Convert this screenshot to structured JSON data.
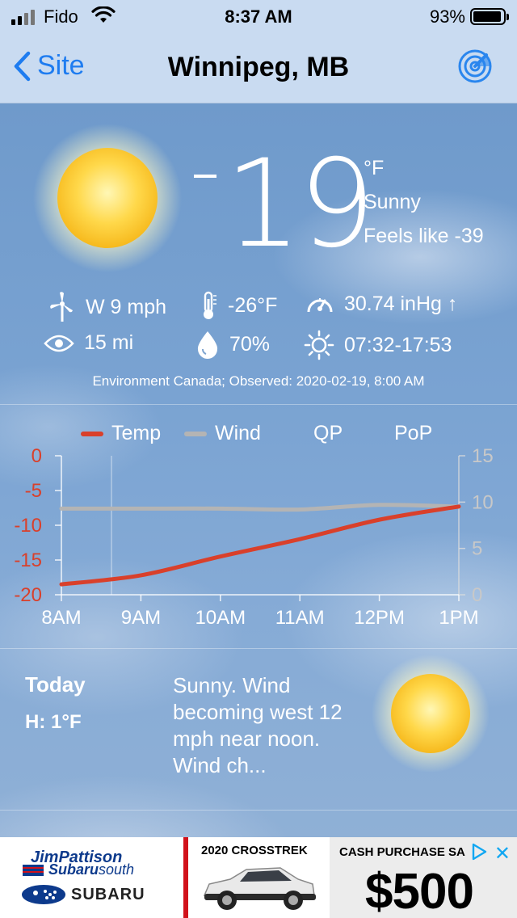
{
  "status_bar": {
    "carrier": "Fido",
    "time": "8:37 AM",
    "battery": "93%"
  },
  "nav": {
    "back_label": "Site",
    "title": "Winnipeg, MB",
    "radar_icon": "radar-icon"
  },
  "current": {
    "minus": "-",
    "temperature": "19",
    "unit": "°F",
    "condition": "Sunny",
    "feels_like": "Feels like -39",
    "wind": "W 9 mph",
    "dewpoint": "-26°F",
    "pressure": "30.74 inHg ↑",
    "visibility": "15 mi",
    "humidity": "70%",
    "sun_times": "07:32-17:53",
    "source": "Environment Canada; Observed: 2020-02-19, 8:00 AM"
  },
  "legend": {
    "temp": "Temp",
    "wind": "Wind",
    "qp": "QP",
    "pop": "PoP"
  },
  "colors": {
    "temp": "#d9402b",
    "wind": "#b4b4b4",
    "axis_left": "#d9402b",
    "axis_right": "#c8c8c8"
  },
  "chart_data": {
    "type": "line",
    "x": [
      "8AM",
      "9AM",
      "10AM",
      "11AM",
      "12PM",
      "1PM"
    ],
    "series": [
      {
        "name": "Temp",
        "axis": "left",
        "values": [
          -18.5,
          -17.2,
          -14.5,
          -12.0,
          -9.2,
          -7.3
        ]
      },
      {
        "name": "Wind",
        "axis": "right",
        "values": [
          9.3,
          9.3,
          9.3,
          9.2,
          9.7,
          9.5
        ]
      }
    ],
    "y_left": {
      "ticks": [
        "0",
        "-5",
        "-10",
        "-15",
        "-20"
      ],
      "range": [
        -20,
        0
      ]
    },
    "y_right": {
      "ticks": [
        "15",
        "10",
        "5",
        "0"
      ],
      "range": [
        0,
        15
      ]
    },
    "x_ticks": [
      "8AM",
      "9AM",
      "10AM",
      "11AM",
      "12PM",
      "1PM"
    ],
    "now_marker_x": 0.63
  },
  "today": {
    "label": "Today",
    "high": "H: 1°F",
    "forecast": "Sunny. Wind becoming west 12 mph near noon. Wind ch..."
  },
  "ad": {
    "brand_line1": "JimPattison",
    "brand_line2_bold": "Subaru",
    "brand_line2": "south",
    "brand_subaru": "SUBARU",
    "model": "2020 CROSSTREK",
    "cash": "CASH PURCHASE SA",
    "price": "$500"
  }
}
